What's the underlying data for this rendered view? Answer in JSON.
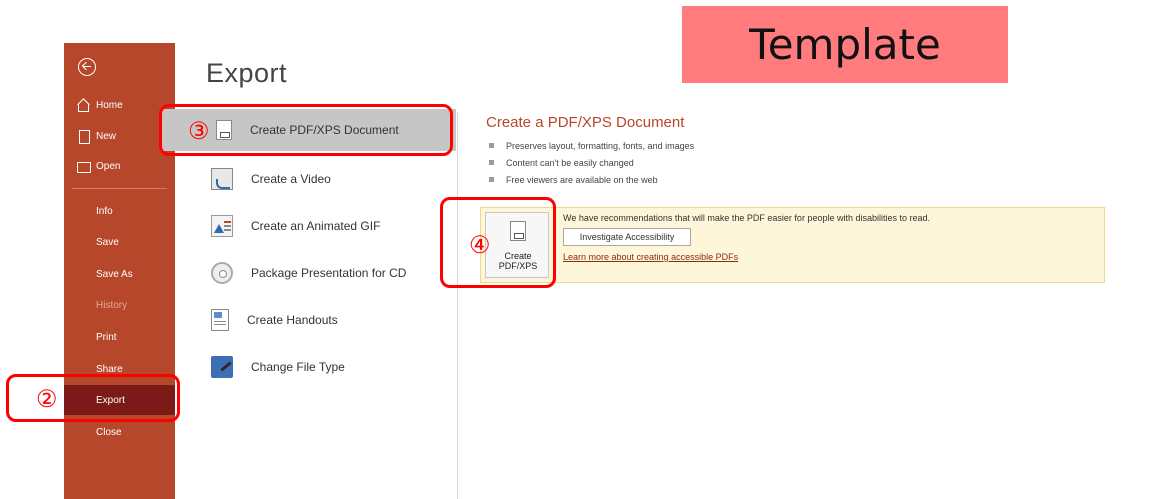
{
  "banner": {
    "text": "Template"
  },
  "sidebar": {
    "items": [
      {
        "label": "Home"
      },
      {
        "label": "New"
      },
      {
        "label": "Open"
      },
      {
        "label": "Info"
      },
      {
        "label": "Save"
      },
      {
        "label": "Save As"
      },
      {
        "label": "History"
      },
      {
        "label": "Print"
      },
      {
        "label": "Share"
      },
      {
        "label": "Export"
      },
      {
        "label": "Close"
      }
    ],
    "accent_color": "#b7472a",
    "active_color": "#7b1a17"
  },
  "main": {
    "title": "Export",
    "export_options": [
      {
        "label": "Create PDF/XPS Document"
      },
      {
        "label": "Create a Video"
      },
      {
        "label": "Create an Animated GIF"
      },
      {
        "label": "Package Presentation for CD"
      },
      {
        "label": "Create Handouts"
      },
      {
        "label": "Change File Type"
      }
    ]
  },
  "detail": {
    "title": "Create a PDF/XPS Document",
    "bullets": [
      "Preserves layout, formatting, fonts, and images",
      "Content can't be easily changed",
      "Free viewers are available on the web"
    ],
    "create_button_label_1": "Create",
    "create_button_label_2": "PDF/XPS",
    "accessibility_message": "We have recommendations that will make the PDF easier for people with disabilities to read.",
    "investigate_label": "Investigate Accessibility",
    "learn_more_link": "Learn more about creating accessible PDFs"
  },
  "callouts": {
    "step2": "②",
    "step3": "③",
    "step4": "④"
  }
}
